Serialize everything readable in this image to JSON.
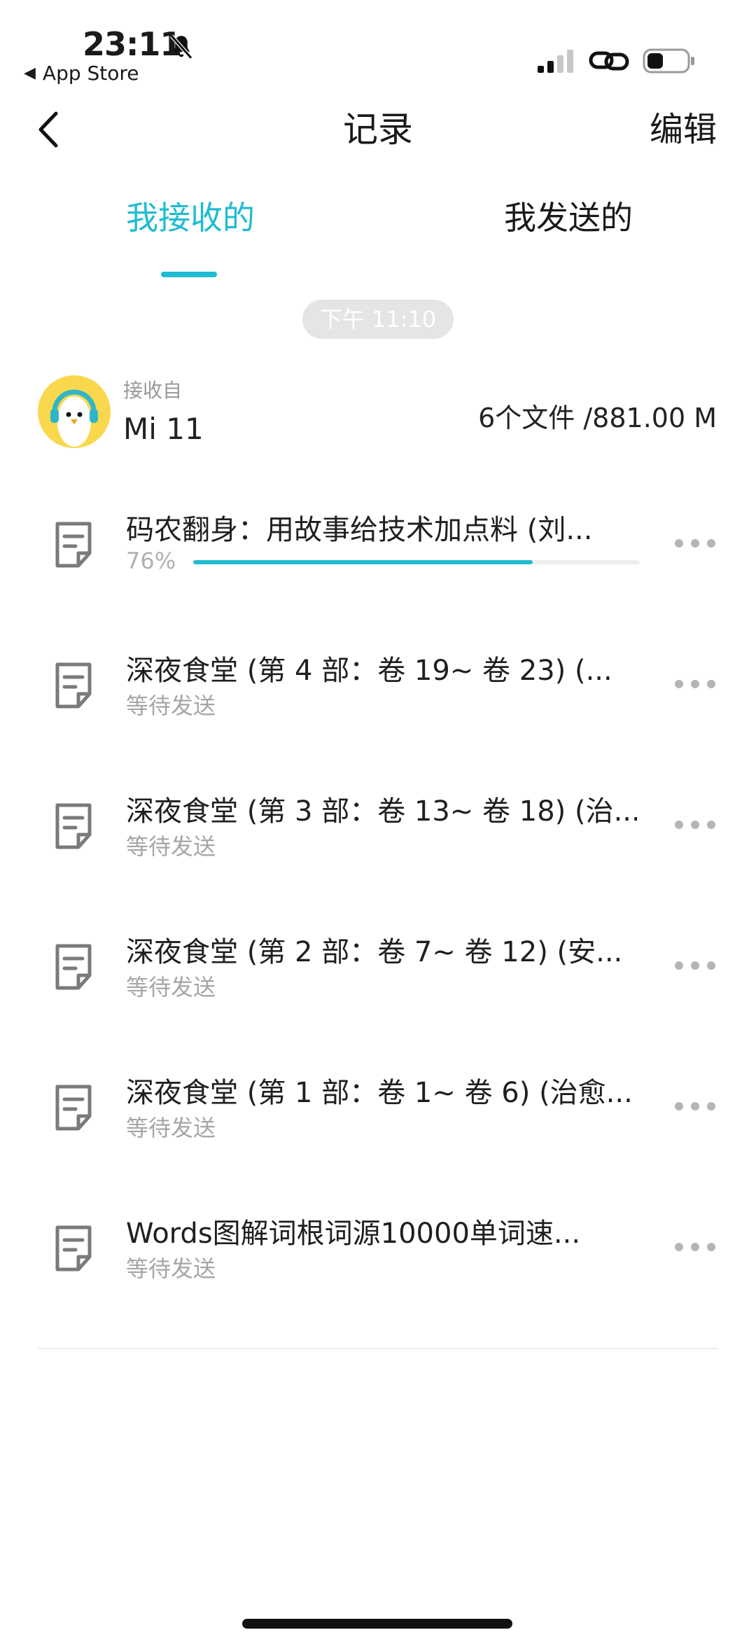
{
  "status_bar": {
    "time": "23:11",
    "back_app": "App Store",
    "icons": [
      "bell-slash-icon",
      "signal-icon",
      "link-icon",
      "battery-icon"
    ]
  },
  "nav": {
    "title": "记录",
    "edit_label": "编辑",
    "back_icon": "chevron-left-icon"
  },
  "tabs": [
    {
      "label": "我接收的",
      "active": true
    },
    {
      "label": "我发送的",
      "active": false
    }
  ],
  "timestamp": "下午 11:10",
  "sender": {
    "received_from_label": "接收自",
    "device": "Mi 11",
    "summary": "6个文件 /881.00 M"
  },
  "files": [
    {
      "name": "码农翻身：用故事给技术加点料 (刘...",
      "status": "76%",
      "progress": 0.76
    },
    {
      "name": "深夜食堂 (第 4 部：卷 19~ 卷 23) (...",
      "status": "等待发送"
    },
    {
      "name": "深夜食堂 (第 3 部：卷 13~ 卷 18) (治...",
      "status": "等待发送"
    },
    {
      "name": "深夜食堂 (第 2 部：卷 7~ 卷 12) (安...",
      "status": "等待发送"
    },
    {
      "name": "深夜食堂 (第 1 部：卷 1~ 卷 6) (治愈...",
      "status": "等待发送"
    },
    {
      "name": "Words图解词根词源10000单词速...",
      "status": "等待发送"
    }
  ],
  "colors": {
    "accent": "#1fbcd2",
    "avatar_bg": "#f9d84d",
    "secondary_text": "#a6a6a6"
  }
}
